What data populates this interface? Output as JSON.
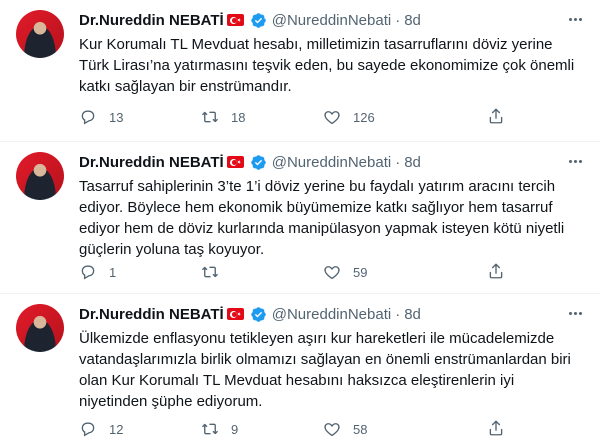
{
  "tweets": [
    {
      "name": "Dr.Nureddin NEBATİ",
      "handle": "@NureddinNebati",
      "separator": "·",
      "age": "8d",
      "text": "Kur Korumalı TL Mevduat hesabı, milletimizin tasarruflarını döviz yerine Türk Lirası’na yatırmasını teşvik eden, bu sayede ekonomimize çok önemli katkı sağlayan bir enstrümandır.",
      "replies": "13",
      "retweets": "18",
      "likes": "126"
    },
    {
      "name": "Dr.Nureddin NEBATİ",
      "handle": "@NureddinNebati",
      "separator": "·",
      "age": "8d",
      "text": "Tasarruf sahiplerinin 3’te 1’i döviz yerine bu faydalı yatırım aracını tercih ediyor. Böylece hem ekonomik büyümemize katkı sağlıyor hem tasarruf ediyor hem de döviz kurlarında manipülasyon yapmak isteyen kötü niyetli güçlerin yoluna taş koyuyor.",
      "replies": "1",
      "retweets": "",
      "likes": "59"
    },
    {
      "name": "Dr.Nureddin NEBATİ",
      "handle": "@NureddinNebati",
      "separator": "·",
      "age": "8d",
      "text": "Ülkemizde enflasyonu tetikleyen aşırı kur hareketleri ile mücadelemizde vatandaşlarımızla birlik olmamızı sağlayan en önemli enstrümanlardan biri olan Kur Korumalı TL Mevduat hesabını haksızca eleştirenlerin iyi niyetinden şüphe ediyorum.",
      "replies": "12",
      "retweets": "9",
      "likes": "58"
    }
  ],
  "colors": {
    "text": "#0f1419",
    "muted": "#536471",
    "verified": "#1d9bf0",
    "divider": "#eff3f4",
    "flag": "#e30a17"
  },
  "icons": [
    "profile-avatar",
    "turkish-flag-icon",
    "verified-badge-icon",
    "more-options-icon",
    "reply-icon",
    "retweet-icon",
    "like-icon",
    "share-icon"
  ]
}
